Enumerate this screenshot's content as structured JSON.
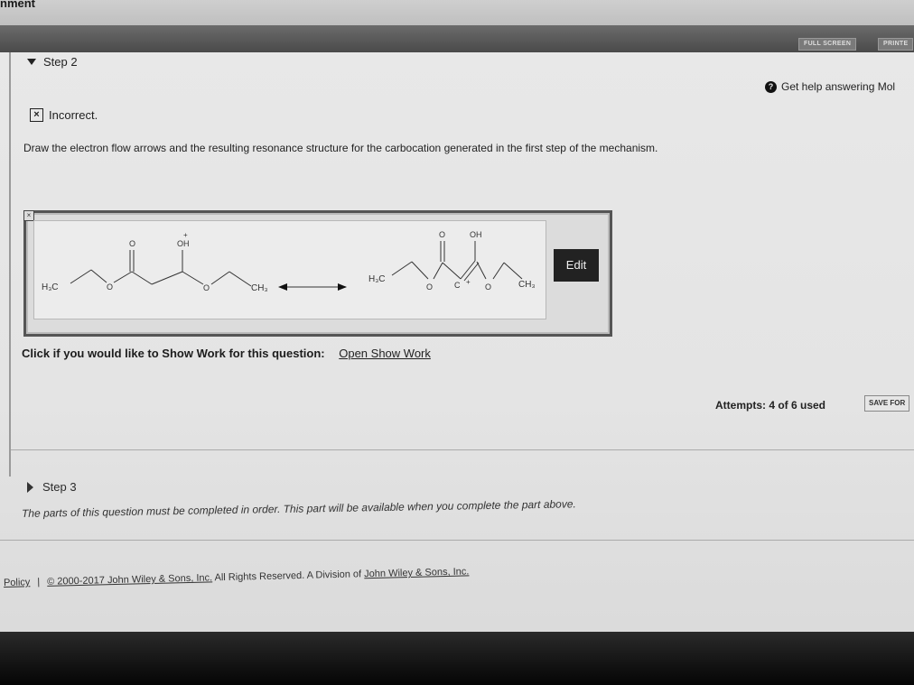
{
  "app": {
    "title_fragment": "nment"
  },
  "header": {
    "fullscreen_label": "FULL SCREEN",
    "print_label": "PRINTE"
  },
  "step2": {
    "label": "Step 2"
  },
  "help": {
    "icon": "help-circle-icon",
    "text": "Get help answering Mol"
  },
  "status": {
    "icon": "x-box-icon",
    "text": "Incorrect."
  },
  "question": {
    "text": "Draw the electron flow arrows and the resulting resonance structure for the carbocation generated in the first step of the mechanism."
  },
  "molecule": {
    "left": {
      "h3c": "H₃C",
      "o_ester": "O",
      "o_carbonyl": "O",
      "oh_plus": "OH",
      "plus": "+",
      "o_ether": "O",
      "ch3": "CH₃"
    },
    "right": {
      "h3c": "H₃C",
      "o_ester": "O",
      "o_carbonyl": "O",
      "oh": "OH",
      "plus": "+",
      "c": "C",
      "o_ether": "O",
      "ch3": "CH₃"
    }
  },
  "edit_button": {
    "label": "Edit"
  },
  "show_work": {
    "label": "Click if you would like to Show Work for this question:",
    "link": "Open Show Work"
  },
  "attempts": {
    "text": "Attempts: 4 of 6 used"
  },
  "save_button": {
    "label": "SAVE FOR"
  },
  "step3": {
    "label": "Step 3",
    "note": "The parts of this question must be completed in order. This part will be available when you complete the part above."
  },
  "footer": {
    "policy": "Policy",
    "separator": "|",
    "copyright_link": "© 2000-2017 John Wiley & Sons, Inc.",
    "rights": "All Rights Reserved. A Division of",
    "division_link": "John Wiley & Sons, Inc."
  }
}
